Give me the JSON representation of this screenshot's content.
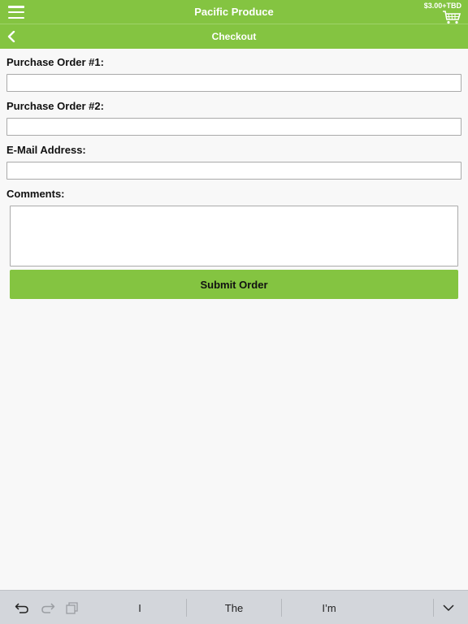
{
  "header": {
    "app_title": "Pacific Produce",
    "cart_total": "$3.00+TBD",
    "page_title": "Checkout"
  },
  "form": {
    "po1_label": "Purchase Order #1:",
    "po1_value": "",
    "po2_label": "Purchase Order #2:",
    "po2_value": "",
    "email_label": "E-Mail Address:",
    "email_value": "",
    "comments_label": "Comments:",
    "comments_value": "",
    "submit_label": "Submit Order"
  },
  "keyboard": {
    "suggestions": [
      "I",
      "The",
      "I’m"
    ]
  },
  "colors": {
    "accent": "#84c441",
    "keyboard_bar": "#d3d6db"
  },
  "icons": [
    "menu-icon",
    "cart-icon",
    "back-icon",
    "undo-icon",
    "redo-icon",
    "paste-icon",
    "chevron-down-icon"
  ]
}
